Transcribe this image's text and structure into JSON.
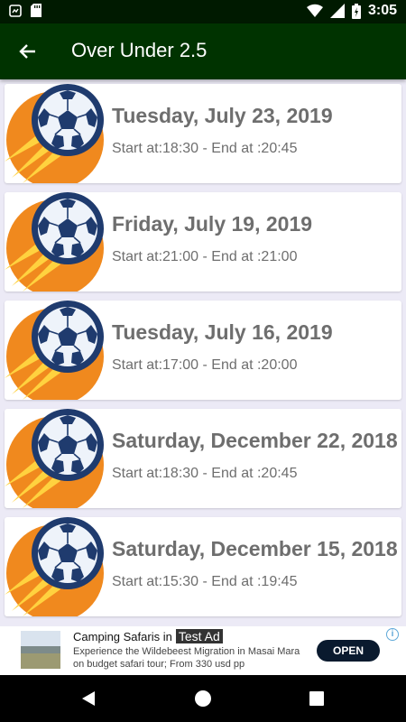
{
  "status_bar": {
    "time": "3:05",
    "battery_level": ""
  },
  "app_bar": {
    "title": "Over Under 2.5"
  },
  "matches": [
    {
      "date": "Tuesday, July 23, 2019",
      "time": "Start at:18:30 - End at :20:45"
    },
    {
      "date": "Friday, July 19, 2019",
      "time": "Start at:21:00 - End at :21:00"
    },
    {
      "date": "Tuesday, July 16, 2019",
      "time": "Start at:17:00 - End at :20:00"
    },
    {
      "date": "Saturday, December 22, 2018",
      "time": "Start at:18:30 - End at :20:45"
    },
    {
      "date": "Saturday, December 15, 2018",
      "time": "Start at:15:30 - End at :19:45"
    }
  ],
  "ad": {
    "title": "Camping Safaris in",
    "badge": "Test Ad",
    "description": "Experience the Wildebeest Migration in Masai Mara on budget safari tour; From 330 usd pp",
    "button": "OPEN"
  },
  "colors": {
    "app_bar": "#003300",
    "status_bar": "#001A00",
    "background": "#ECEAF6",
    "ball_orange": "#F0891E",
    "ball_navy": "#1F3B6E"
  }
}
